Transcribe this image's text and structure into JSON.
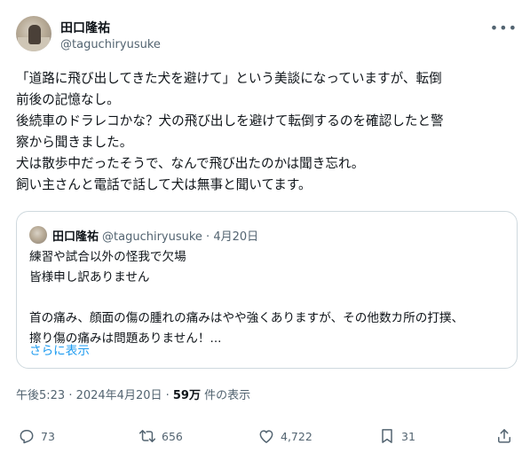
{
  "author": {
    "display_name": "田口隆祐",
    "handle": "@taguchiryusuke",
    "more_icon": "more-horizontal-icon"
  },
  "tweet": {
    "lines": [
      "「道路に飛び出してきた犬を避けて」という美談になっていますが、転倒",
      "前後の記憶なし。",
      "後続車のドラレコかな？犬の飛び出しを避けて転倒するのを確認したと警",
      "察から聞きました。",
      "犬は散歩中だったそうで、なんで飛び出たのかは聞き忘れ。",
      "飼い主さんと電話で話して犬は無事と聞いてます。"
    ]
  },
  "quote": {
    "display_name": "田口隆祐",
    "handle_date": "@taguchiryusuke · 4月20日",
    "lines": [
      "練習や試合以外の怪我で欠場",
      "皆様申し訳ありません",
      "",
      "首の痛み、顔面の傷の腫れの痛みはやや強くありますが、その他数カ所の打撲、",
      "擦り傷の痛みは問題ありません！..."
    ],
    "show_more": "さらに表示"
  },
  "meta": {
    "timestamp": "午後5:23 · 2024年4月20日 · ",
    "views_count": "59万",
    "views_label": " 件の表示"
  },
  "actions": {
    "replies": "73",
    "reposts": "656",
    "likes": "4,722",
    "bookmarks": "31"
  }
}
